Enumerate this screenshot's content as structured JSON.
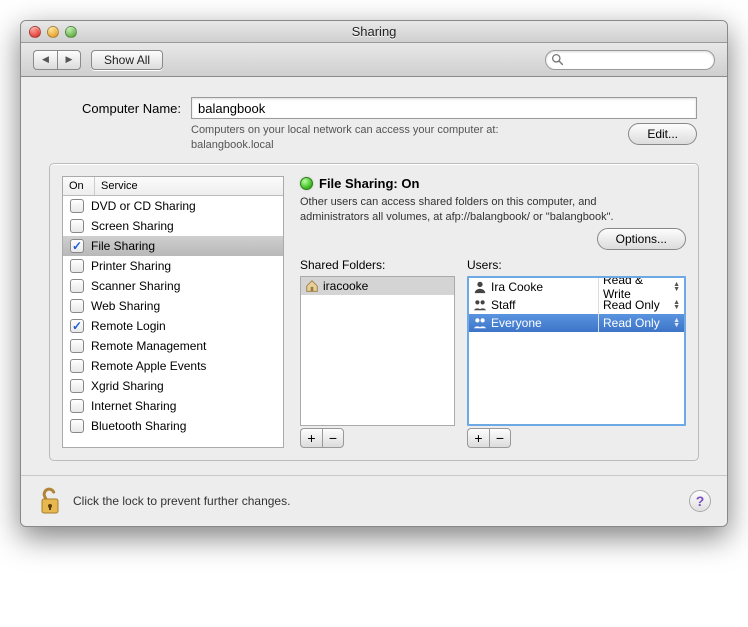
{
  "window": {
    "title": "Sharing"
  },
  "toolbar": {
    "back_label": "◀",
    "fwd_label": "▶",
    "showall_label": "Show All",
    "search_placeholder": ""
  },
  "computer_name": {
    "label": "Computer Name:",
    "value": "balangbook",
    "hint1": "Computers on your local network can access your computer at:",
    "hint2": "balangbook.local",
    "edit_label": "Edit..."
  },
  "services": {
    "head_on": "On",
    "head_service": "Service",
    "items": [
      {
        "label": "DVD or CD Sharing",
        "checked": false,
        "selected": false
      },
      {
        "label": "Screen Sharing",
        "checked": false,
        "selected": false
      },
      {
        "label": "File Sharing",
        "checked": true,
        "selected": true
      },
      {
        "label": "Printer Sharing",
        "checked": false,
        "selected": false
      },
      {
        "label": "Scanner Sharing",
        "checked": false,
        "selected": false
      },
      {
        "label": "Web Sharing",
        "checked": false,
        "selected": false
      },
      {
        "label": "Remote Login",
        "checked": true,
        "selected": false
      },
      {
        "label": "Remote Management",
        "checked": false,
        "selected": false
      },
      {
        "label": "Remote Apple Events",
        "checked": false,
        "selected": false
      },
      {
        "label": "Xgrid Sharing",
        "checked": false,
        "selected": false
      },
      {
        "label": "Internet Sharing",
        "checked": false,
        "selected": false
      },
      {
        "label": "Bluetooth Sharing",
        "checked": false,
        "selected": false
      }
    ]
  },
  "status": {
    "title": "File Sharing: On",
    "desc": "Other users can access shared folders on this computer, and administrators all volumes, at afp://balangbook/ or \"balangbook\".",
    "options_label": "Options..."
  },
  "shared_folders": {
    "label": "Shared Folders:",
    "items": [
      {
        "name": "iracooke",
        "selected": true
      }
    ],
    "add": "+",
    "remove": "−"
  },
  "users": {
    "label": "Users:",
    "items": [
      {
        "name": "Ira Cooke",
        "perm": "Read & Write",
        "icon": "person",
        "hl": false
      },
      {
        "name": "Staff",
        "perm": "Read Only",
        "icon": "group",
        "hl": false
      },
      {
        "name": "Everyone",
        "perm": "Read Only",
        "icon": "group",
        "hl": true
      }
    ],
    "add": "+",
    "remove": "−"
  },
  "footer": {
    "text": "Click the lock to prevent further changes.",
    "help": "?"
  }
}
